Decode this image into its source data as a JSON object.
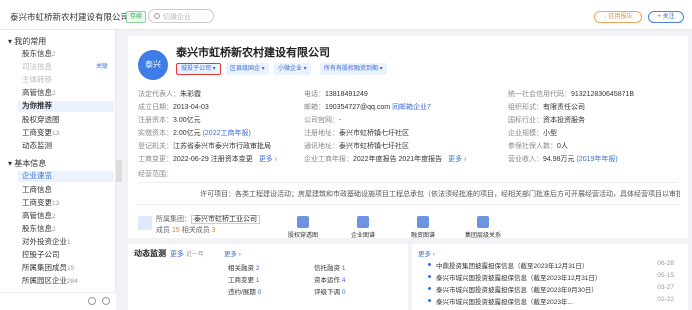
{
  "header": {
    "company": "泰兴市虹桥新农村建设有限公司",
    "status_badge": "存续",
    "search_placeholder": "切换企业",
    "report_button": "↓ 信用报告",
    "follow_button": "+ 关注"
  },
  "sidebar": {
    "section_common": "我的常用",
    "section_basic": "基本信息",
    "common_items": [
      {
        "label": "股东信息",
        "count": "2",
        "style": "normal"
      },
      {
        "label": "司法信息",
        "count": "",
        "style": "dim"
      },
      {
        "label": "主体转移",
        "count": "",
        "style": "dim"
      },
      {
        "label": "高管信息",
        "count": "2",
        "style": "normal"
      },
      {
        "label": "为你推荐",
        "count": "",
        "style": "hl"
      },
      {
        "label": "股权穿透图",
        "count": "",
        "style": "normal"
      },
      {
        "label": "工商变更",
        "count": "13",
        "style": "normal"
      },
      {
        "label": "动态监测",
        "count": "",
        "style": "normal"
      }
    ],
    "common_link": "关联",
    "basic_items": [
      {
        "label": "企业速览",
        "count": "",
        "style": "active"
      },
      {
        "label": "工商信息",
        "count": "",
        "style": "normal"
      },
      {
        "label": "工商变更",
        "count": "13",
        "style": "normal"
      },
      {
        "label": "高管信息",
        "count": "2",
        "style": "normal"
      },
      {
        "label": "股东信息",
        "count": "2",
        "style": "normal"
      },
      {
        "label": "对外投资企业",
        "count": "1",
        "style": "normal"
      },
      {
        "label": "控股子公司",
        "count": "",
        "style": "normal"
      },
      {
        "label": "所属集团成员",
        "count": "15",
        "style": "normal"
      },
      {
        "label": "所属园区企业",
        "count": "284",
        "style": "normal"
      }
    ]
  },
  "company": {
    "logo_text": "泰兴",
    "name": "泰兴市虹桥新农村建设有限公司",
    "tags": [
      "城投子公司 ▾",
      "区县级国企 ▾",
      "小微企业 ▾",
      "所有有股权融资到期 ▾"
    ],
    "legal_rep_label": "法定代表人：",
    "legal_rep": "朱彩霞",
    "founded_label": "成立日期：",
    "founded": "2013-04-03",
    "reg_capital_label": "注册资本：",
    "reg_capital": "3.00亿元",
    "paid_capital_label": "实缴资本：",
    "paid_capital": "2.00亿元",
    "paid_capital_note": "(2022工商年报)",
    "reg_authority_label": "登记机关：",
    "reg_authority": "江苏省泰兴市泰兴市行政审批局",
    "period_label": "工商变更：",
    "period": "2022-06-29 注册资本变更",
    "more": "更多 ›",
    "phone_label": "电话：",
    "phone": "13818491249",
    "email_label": "邮箱：",
    "email": "190354727@qq.com",
    "email_link": "同邮箱企业7",
    "website_label": "公司官网：",
    "website": "-",
    "reg_addr_label": "注册地址：",
    "reg_addr": "泰兴市虹桥镇七圩社区",
    "comm_addr_label": "通讯地址：",
    "comm_addr": "泰兴市虹桥镇七圩社区",
    "annual_label": "企业工商年报：",
    "annual1": "2022年度报告",
    "annual2": "2021年度报告",
    "credit_code_label": "统一社会信用代码：",
    "credit_code": "913212830645871B",
    "org_type_label": "组织形式：",
    "org_type": "有限责任公司",
    "industry_label": "国标行业：",
    "industry": "资本投资服务",
    "scale_label": "企业规模：",
    "scale": "小型",
    "insured_label": "参保社保人数：",
    "insured": "0人",
    "revenue_label": "营业收入：",
    "revenue": "94.98万元",
    "revenue_note": "(2019年年报)",
    "history_label": "经营范围：",
    "scope": "许可项目：各类工程建设活动；房屋建筑和市政基础设施项目工程总承包（依法须经批准的项目，经相关部门批准后方可开展经营活动，具体经营项目以审批..."
  },
  "group": {
    "label": "所属集团：",
    "name": "泰兴市虹桥工业公司",
    "members_label": "成员",
    "members": "15",
    "related_label": "相关成员",
    "related": "3"
  },
  "tools": [
    "股权穿透图",
    "企业图谱",
    "融资图谱",
    "集团层级关系"
  ],
  "dynamics": {
    "title": "动态监测",
    "link": "更多",
    "sub": "近一年",
    "rows": [
      {
        "k": "相关融资",
        "v": "2"
      },
      {
        "k": "工商变更",
        "v": "1"
      },
      {
        "k": "违约/展期",
        "v": "0"
      }
    ],
    "rows2": [
      {
        "k": "信托融资",
        "v": "1"
      },
      {
        "k": "资本运作",
        "v": "4"
      },
      {
        "k": "评级下调",
        "v": "0"
      }
    ],
    "more": "更多 ›"
  },
  "news": {
    "items": [
      {
        "t": "中鼎投资集团披露担保信息（截至2023年12月31日）",
        "d": "06-28"
      },
      {
        "t": "泰兴市城兴国投资披露担保信息（截至2023年12月31日）",
        "d": "05-15"
      },
      {
        "t": "泰兴市城兴国投资披露担保信息（截至2023年9月30日）",
        "d": "03-27"
      },
      {
        "t": "泰兴市城兴国投资披露担保信息（截至2023年...",
        "d": "02-22"
      }
    ],
    "more": "更多 ›"
  }
}
